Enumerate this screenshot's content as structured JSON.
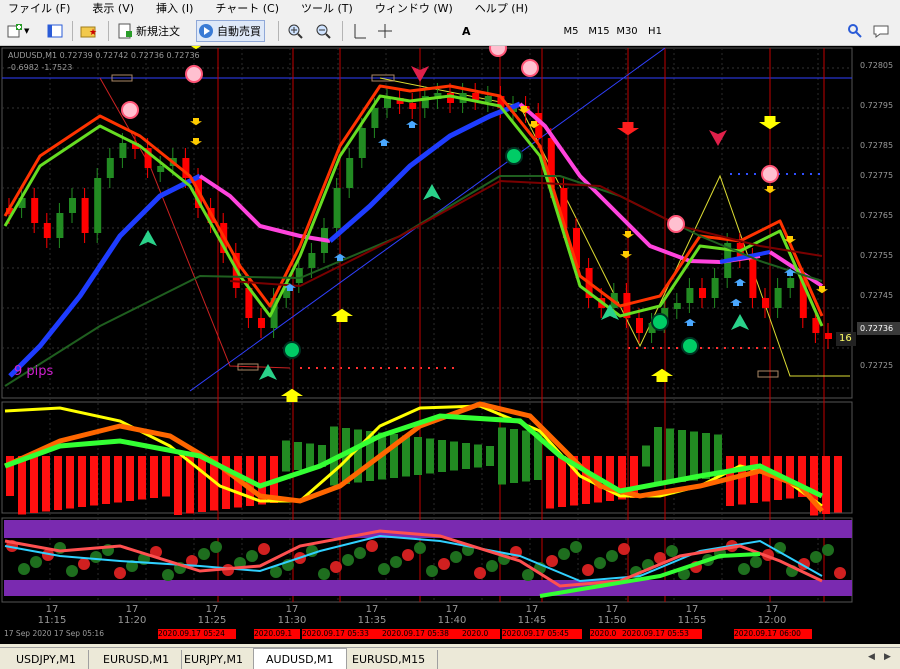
{
  "menu": [
    "ファイル (F)",
    "表示 (V)",
    "挿入 (I)",
    "チャート (C)",
    "ツール (T)",
    "ウィンドウ (W)",
    "ヘルプ (H)"
  ],
  "toolbar": {
    "new_order": "新規注文",
    "auto_trade": "自動売買",
    "timeframes": [
      "M5",
      "M15",
      "M30",
      "H1"
    ],
    "text_tool": "A"
  },
  "chart_header": {
    "symbol_line": "AUDUSD,M1  0.72739 0.72742 0.72736 0.72736",
    "sub_line": "-0.6982  -1.7523"
  },
  "pips_label": "9 pips",
  "current_price": "0.72736",
  "price_tag_right": "16",
  "price_axis": [
    "0.72805",
    "0.72795",
    "0.72785",
    "0.72775",
    "0.72765",
    "0.72755",
    "0.72745",
    "0.72736",
    "0.72725"
  ],
  "time_axis": [
    {
      "day": "17",
      "time": "11:15"
    },
    {
      "day": "17",
      "time": "11:20"
    },
    {
      "day": "17",
      "time": "11:25"
    },
    {
      "day": "17",
      "time": "11:30"
    },
    {
      "day": "17",
      "time": "11:35"
    },
    {
      "day": "17",
      "time": "11:40"
    },
    {
      "day": "17",
      "time": "11:45"
    },
    {
      "day": "17",
      "time": "11:50"
    },
    {
      "day": "17",
      "time": "11:55"
    },
    {
      "day": "17",
      "time": "12:00"
    }
  ],
  "date_bar_left": "17 Sep 2020   17 Sep 05:16",
  "date_labels": [
    "2020.09.17 05:24",
    "2020.09.1",
    "2020.09.17 05:33",
    "2020.09.17 05:38",
    "2020.0",
    "2020.09.17 05:45",
    "2020.0",
    "2020.09.17 05:53",
    "2020.09.17 06:00"
  ],
  "tabs": [
    {
      "label": "USDJPY,M1",
      "active": false
    },
    {
      "label": "EURUSD,M1",
      "active": false
    },
    {
      "label": "EURJPY,M1",
      "active": false
    },
    {
      "label": "AUDUSD,M1",
      "active": true
    },
    {
      "label": "EURUSD,M15",
      "active": false
    }
  ],
  "colors": {
    "chart_bg": "#000000",
    "bull_candle": "#228b22",
    "bear_candle": "#ff0000",
    "ma_blue": "#1e3cff",
    "ma_magenta": "#ff44dd",
    "signal_yellow": "#ffff00",
    "signal_red": "#ff1e1e",
    "vline": "#c00000"
  }
}
